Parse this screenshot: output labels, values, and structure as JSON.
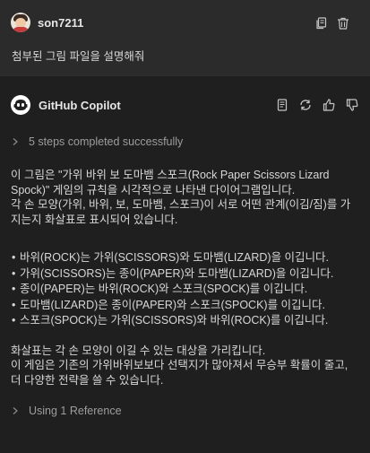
{
  "user": {
    "name": "son7211",
    "message": "첨부된 그림 파일을 설명해줘"
  },
  "bot": {
    "name": "GitHub Copilot",
    "steps": "5 steps completed successfully",
    "intro": [
      "이 그림은 \"가위 바위 보 도마뱀 스포크(Rock Paper Scissors Lizard Spock)\" 게임의 규칙을 시각적으로 나타낸 다이어그램입니다.",
      "각 손 모양(가위, 바위, 보, 도마뱀, 스포크)이 서로 어떤 관계(이김/짐)를 가지는지 화살표로 표시되어 있습니다."
    ],
    "bullets": [
      "바위(ROCK)는 가위(SCISSORS)와 도마뱀(LIZARD)을 이깁니다.",
      "가위(SCISSORS)는 종이(PAPER)와 도마뱀(LIZARD)을 이깁니다.",
      "종이(PAPER)는 바위(ROCK)와 스포크(SPOCK)를 이깁니다.",
      "도마뱀(LIZARD)은 종이(PAPER)와 스포크(SPOCK)를 이깁니다.",
      "스포크(SPOCK)는 가위(SCISSORS)와 바위(ROCK)를 이깁니다."
    ],
    "summary": [
      "화살표는 각 손 모양이 이길 수 있는 대상을 가리킵니다.",
      "이 게임은 기존의 가위바위보보다 선택지가 많아져서 무승부 확률이 줄고, 더 다양한 전략을 쓸 수 있습니다."
    ],
    "references": "Using 1 Reference"
  },
  "icons": {
    "copy": "copy-icon",
    "delete": "trash-icon",
    "insert": "insert-icon",
    "retry": "refresh-icon",
    "like": "thumbs-up-icon",
    "dislike": "thumbs-down-icon",
    "bot": "copilot-icon",
    "chevron": "chevron-right-icon"
  }
}
